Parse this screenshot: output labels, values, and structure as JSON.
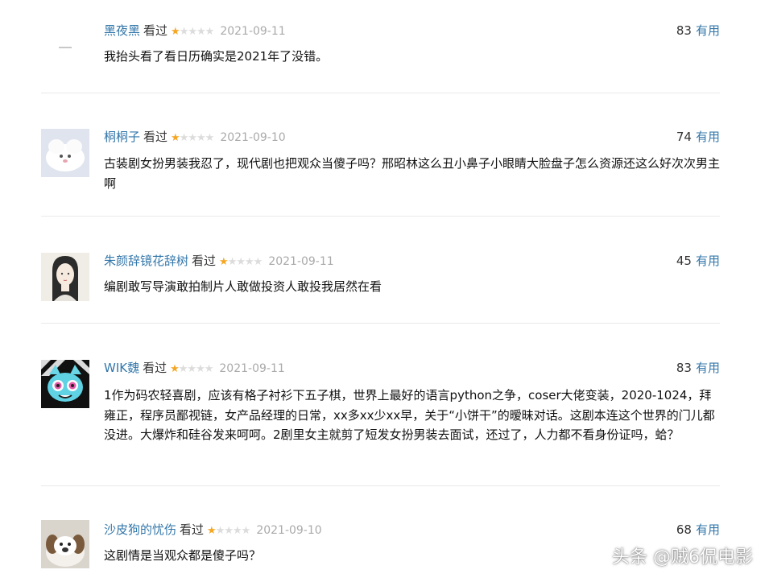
{
  "reviews": [
    {
      "username": "黑夜黑",
      "status": "看过",
      "rating": 1,
      "date": "2021-09-11",
      "votes": "83",
      "vote_label": "有用",
      "content": "我抬头看了看日历确实是2021年了没错。"
    },
    {
      "username": "桐桐子",
      "status": "看过",
      "rating": 1,
      "date": "2021-09-10",
      "votes": "74",
      "vote_label": "有用",
      "content": "古装剧女扮男装我忍了，现代剧也把观众当傻子吗？邢昭林这么丑小鼻子小眼睛大脸盘子怎么资源还这么好次次男主啊"
    },
    {
      "username": "朱颜辞镜花辞树",
      "status": "看过",
      "rating": 1,
      "date": "2021-09-11",
      "votes": "45",
      "vote_label": "有用",
      "content": "编剧敢写导演敢拍制片人敢做投资人敢投我居然在看"
    },
    {
      "username": "WIK魏",
      "status": "看过",
      "rating": 1,
      "date": "2021-09-11",
      "votes": "83",
      "vote_label": "有用",
      "content": "1作为码农轻喜剧，应该有格子衬衫下五子棋，世界上最好的语言python之争，coser大佬变装，2020-1024，拜雍正，程序员鄙视链，女产品经理的日常，xx多xx少xx早，关于“小饼干”的暧昧对话。这剧本连这个世界的门儿都没进。大爆炸和硅谷发来呵呵。2剧里女主就剪了短发女扮男装去面试，还过了，人力都不看身份证吗，蛤？"
    },
    {
      "username": "沙皮狗的忧伤",
      "status": "看过",
      "rating": 1,
      "date": "2021-09-10",
      "votes": "68",
      "vote_label": "有用",
      "content": "这剧情是当观众都是傻子吗？"
    }
  ],
  "watermark": "头条 @贼6侃电影",
  "colors": {
    "username": "#3377aa",
    "star_on": "#f5a623",
    "star_off": "#dcdcdc",
    "date": "#aaaaaa"
  }
}
